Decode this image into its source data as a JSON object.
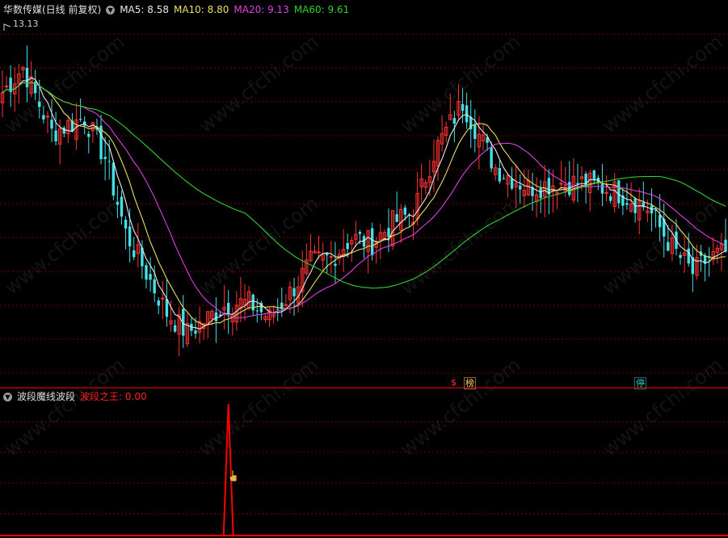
{
  "header": {
    "stock_name": "华数传媒(日线 前复权)",
    "ma5": "MA5: 8.58",
    "ma10": "MA10: 8.80",
    "ma20": "MA20: 9.13",
    "ma60": "MA60: 9.61",
    "high_label": "13.13"
  },
  "indicator": {
    "name": "波段魔线波段",
    "series_label": "波段之王: 0.00"
  },
  "event_marks": [
    {
      "label": "$",
      "color": "#ff3030"
    },
    {
      "label": "榜",
      "color": "#ffcc66"
    },
    {
      "label": "停",
      "color": "#33cccc"
    }
  ],
  "watermark": "www.cfchi.com",
  "colors": {
    "up": "#ff3333",
    "down": "#44e0e8",
    "ma5": "#e8e8e8",
    "ma10": "#e8e060",
    "ma20": "#e040e0",
    "ma60": "#30d030",
    "grid": "#7a0000",
    "indicator": "#ff0000"
  },
  "chart_data": [
    {
      "type": "candlestick",
      "price_high": 13.13,
      "ma_series": [
        {
          "name": "MA5",
          "last": 8.58
        },
        {
          "name": "MA10",
          "last": 8.8
        },
        {
          "name": "MA20",
          "last": 9.13
        },
        {
          "name": "MA60",
          "last": 9.61
        }
      ],
      "price_path": [
        [
          0,
          11.8
        ],
        [
          5,
          12.3
        ],
        [
          12,
          11.0
        ],
        [
          20,
          11.3
        ],
        [
          25,
          10.5
        ],
        [
          30,
          9.0
        ],
        [
          35,
          8.2
        ],
        [
          40,
          7.4
        ],
        [
          45,
          7.0
        ],
        [
          50,
          7.3
        ],
        [
          55,
          7.6
        ],
        [
          60,
          7.6
        ],
        [
          65,
          7.3
        ],
        [
          70,
          7.8
        ],
        [
          75,
          8.4
        ],
        [
          80,
          8.5
        ],
        [
          85,
          8.9
        ],
        [
          90,
          8.8
        ],
        [
          95,
          9.2
        ],
        [
          100,
          9.4
        ],
        [
          105,
          10.6
        ],
        [
          112,
          11.6
        ],
        [
          120,
          10.3
        ],
        [
          128,
          9.9
        ],
        [
          135,
          10.0
        ],
        [
          142,
          10.0
        ],
        [
          150,
          9.8
        ],
        [
          157,
          9.5
        ],
        [
          163,
          8.7
        ],
        [
          168,
          8.2
        ],
        [
          172,
          8.5
        ],
        [
          176,
          8.6
        ]
      ],
      "grid": true
    },
    {
      "type": "line",
      "series": [
        {
          "name": "波段之王",
          "last": 0.0
        }
      ],
      "spike": {
        "x": 55,
        "value": 1.0
      },
      "ylim": [
        0,
        1.0
      ],
      "grid": true
    }
  ]
}
